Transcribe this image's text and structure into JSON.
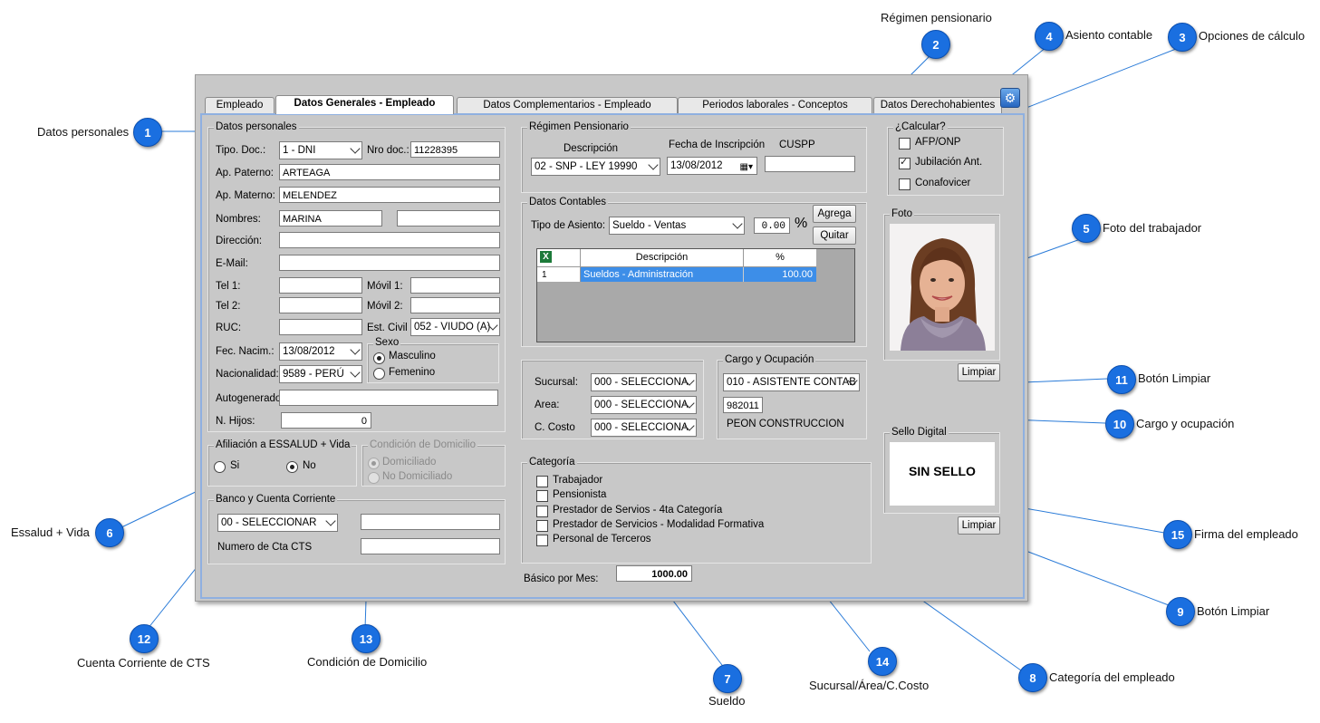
{
  "callouts": [
    {
      "num": "1",
      "label": "Datos personales"
    },
    {
      "num": "2",
      "label": "Régimen pensionario"
    },
    {
      "num": "3",
      "label": "Opciones de cálculo"
    },
    {
      "num": "4",
      "label": "Asiento contable"
    },
    {
      "num": "5",
      "label": "Foto del trabajador"
    },
    {
      "num": "6",
      "label": "Essalud + Vida"
    },
    {
      "num": "7",
      "label": "Sueldo"
    },
    {
      "num": "8",
      "label": "Categoría del empleado"
    },
    {
      "num": "9",
      "label": "Botón Limpiar"
    },
    {
      "num": "10",
      "label": "Cargo y ocupación"
    },
    {
      "num": "11",
      "label": "Botón Limpiar"
    },
    {
      "num": "12",
      "label": "Cuenta Corriente de CTS"
    },
    {
      "num": "13",
      "label": "Condición de Domicilio"
    },
    {
      "num": "14",
      "label": "Sucursal/Área/C.Costo"
    },
    {
      "num": "15",
      "label": "Firma del empleado"
    }
  ],
  "tabs": [
    "Empleado",
    "Datos Generales - Empleado",
    "Datos Complementarios - Empleado",
    "Periodos laborales - Conceptos",
    "Datos Derechohabientes"
  ],
  "personal": {
    "legend": "Datos personales",
    "tipo_doc_label": "Tipo. Doc.:",
    "tipo_doc": "1 - DNI",
    "nro_doc_label": "Nro doc.:",
    "nro_doc": "11228395",
    "ap_paterno_label": "Ap. Paterno:",
    "ap_paterno": "ARTEAGA",
    "ap_materno_label": "Ap. Materno:",
    "ap_materno": "MELENDEZ",
    "nombres_label": "Nombres:",
    "nombres": "MARINA",
    "direccion_label": "Dirección:",
    "email_label": "E-Mail:",
    "tel1_label": "Tel 1:",
    "movil1_label": "Móvil 1:",
    "tel2_label": "Tel 2:",
    "movil2_label": "Móvil 2:",
    "ruc_label": "RUC:",
    "est_civil_label": "Est. Civil",
    "est_civil": "052 - VIUDO (A)",
    "fec_nacim_label": "Fec. Nacim.:",
    "fec_nacim": "13/08/2012",
    "sexo_label": "Sexo",
    "masculino": "Masculino",
    "femenino": "Femenino",
    "nacionalidad_label": "Nacionalidad:",
    "nacionalidad": "9589 - PERÚ",
    "autogenerado_label": "Autogenerado:",
    "n_hijos_label": "N. Hijos:",
    "n_hijos": "0"
  },
  "essalud": {
    "legend": "Afiliación a ESSALUD + Vida",
    "si": "Si",
    "no": "No"
  },
  "domicilio": {
    "legend": "Condición de Domicilio",
    "dom": "Domiciliado",
    "nodom": "No Domiciliado"
  },
  "banco": {
    "legend": "Banco y Cuenta Corriente",
    "banco": "00 - SELECCIONAR",
    "cts_label": "Numero de Cta CTS"
  },
  "regimen": {
    "legend": "Régimen Pensionario",
    "desc_label": "Descripción",
    "desc": "02 - SNP - LEY 19990",
    "fecha_label": "Fecha de Inscripción",
    "fecha": "13/08/2012",
    "cuspp_label": "CUSPP"
  },
  "contables": {
    "legend": "Datos Contables",
    "tipo_label": "Tipo de Asiento:",
    "tipo": "Sueldo - Ventas",
    "pct": "0.00",
    "pct_sign": "%",
    "agrega": "Agrega",
    "quitar": "Quitar",
    "grid_headers": [
      "Descripción",
      "%"
    ],
    "grid_rows": [
      {
        "n": "1",
        "desc": "Sueldos - Administración",
        "pct": "100.00"
      }
    ]
  },
  "calcular": {
    "legend": "¿Calcular?",
    "afp": "AFP/ONP",
    "jub": "Jubilación Ant.",
    "conaf": "Conafovicer"
  },
  "foto": {
    "legend": "Foto",
    "limpiar": "Limpiar"
  },
  "sello": {
    "legend": "Sello Digital",
    "text": "SIN SELLO",
    "limpiar": "Limpiar"
  },
  "sucursal": {
    "sucursal_label": "Sucursal:",
    "sucursal": "000 - SELECCIONA",
    "area_label": "Area:",
    "area": "000 - SELECCIONA",
    "ccosto_label": "C. Costo",
    "ccosto": "000 - SELECCIONA"
  },
  "cargo": {
    "legend": "Cargo y Ocupación",
    "cargo": "010 - ASISTENTE CONTAB",
    "codigo": "982011",
    "ocupacion": "PEON CONSTRUCCION"
  },
  "categoria": {
    "legend": "Categoría",
    "items": [
      "Trabajador",
      "Pensionista",
      "Prestador de Servios - 4ta Categoría",
      "Prestador de Servicios - Modalidad Formativa",
      "Personal de Terceros"
    ]
  },
  "basico": {
    "label": "Básico por Mes:",
    "value": "1000.00"
  }
}
